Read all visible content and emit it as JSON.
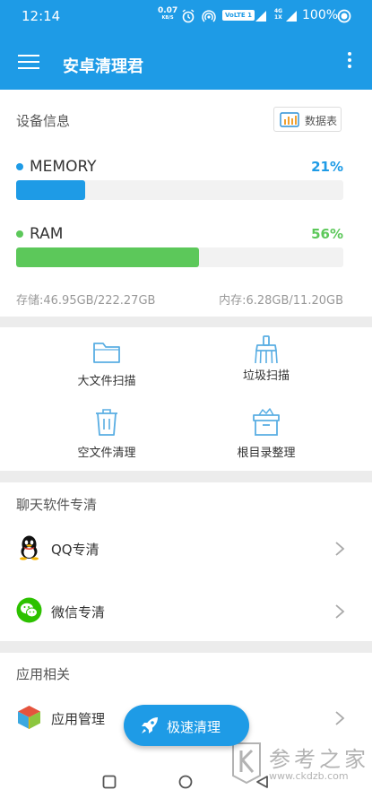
{
  "status_bar": {
    "time": "12:14",
    "net_speed_value": "0.07",
    "net_speed_unit": "KB/S",
    "volte": "VoLTE 1",
    "network_top": "4G",
    "network_bottom": "1X",
    "battery": "100%"
  },
  "app_bar": {
    "title": "安卓清理君"
  },
  "device_info": {
    "title": "设备信息",
    "datatable_label": "数据表",
    "memory": {
      "label": "MEMORY",
      "percent_text": "21%",
      "percent": 21,
      "color": "#1e9be6"
    },
    "ram": {
      "label": "RAM",
      "percent_text": "56%",
      "percent": 56,
      "color": "#5cc85a"
    },
    "storage_text": "存储:46.95GB/222.27GB",
    "ram_text": "内存:6.28GB/11.20GB"
  },
  "tools": [
    {
      "label": "大文件扫描",
      "icon": "folder-icon"
    },
    {
      "label": "垃圾扫描",
      "icon": "broom-icon"
    },
    {
      "label": "空文件清理",
      "icon": "trash-icon"
    },
    {
      "label": "根目录整理",
      "icon": "box-icon"
    }
  ],
  "chat_section": {
    "title": "聊天软件专清",
    "items": [
      {
        "label": "QQ专清",
        "icon": "qq-icon"
      },
      {
        "label": "微信专清",
        "icon": "wechat-icon"
      }
    ]
  },
  "apps_section": {
    "title": "应用相关",
    "items": [
      {
        "label": "应用管理",
        "icon": "cube-icon"
      }
    ]
  },
  "fab": {
    "label": "极速清理",
    "icon": "rocket-icon"
  },
  "watermark": {
    "text": "参考之家",
    "url": "www.ckdzb.com"
  },
  "colors": {
    "primary": "#1e9be6",
    "memory": "#1e9be6",
    "ram": "#5cc85a",
    "icon_line": "#5aaee3"
  }
}
